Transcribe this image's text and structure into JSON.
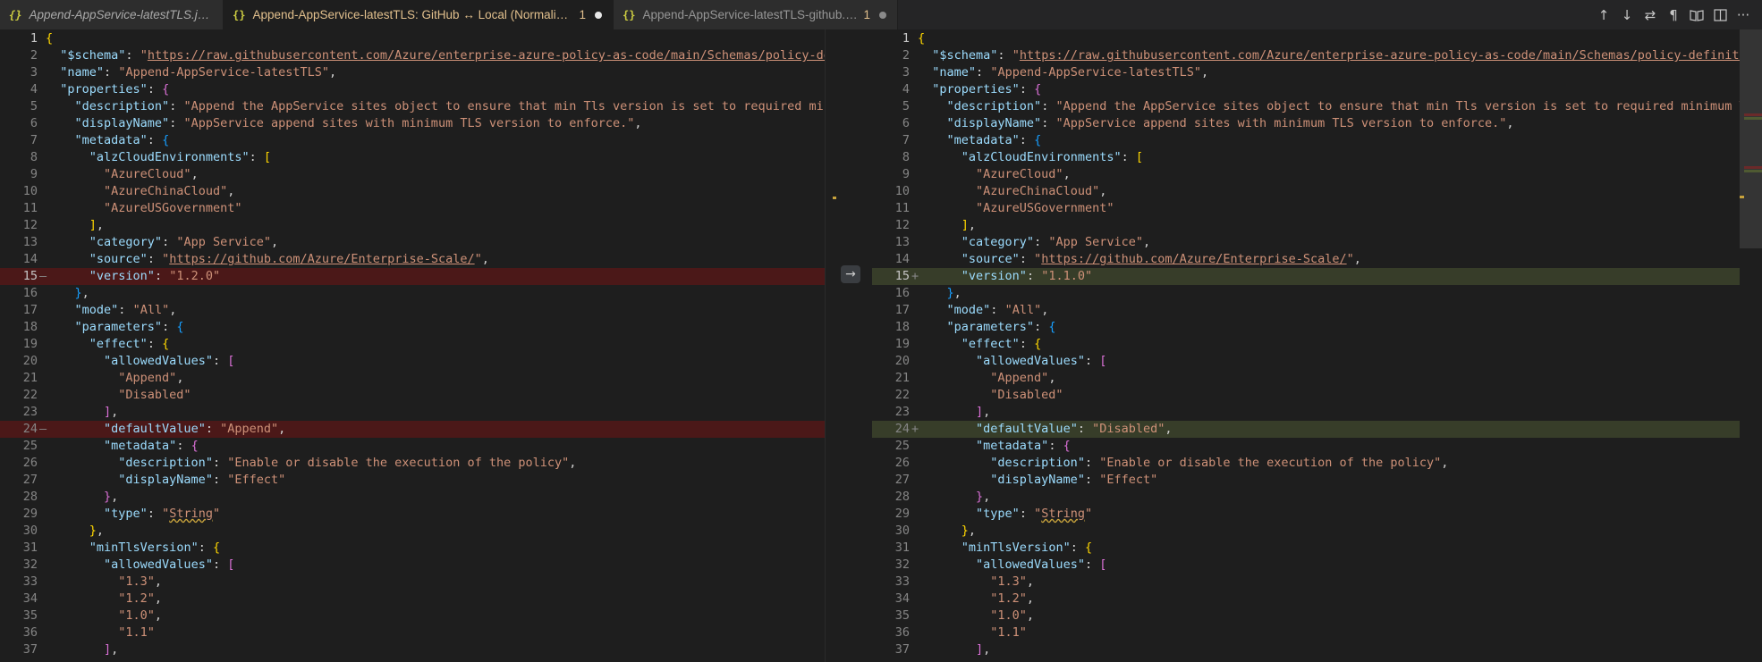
{
  "tabs": [
    {
      "label": "Append-AppService-latestTLS.json",
      "count": "",
      "dirty": false
    },
    {
      "label": "Append-AppService-latestTLS: GitHub ↔ Local (Normalized View)",
      "count": "1",
      "dirty": true
    },
    {
      "label": "Append-AppService-latestTLS-github.json",
      "count": "1",
      "dirty": true
    }
  ],
  "toolbar": {
    "prev_change": "↑",
    "next_change": "↓",
    "swap": "⇄",
    "whitespace": "¶",
    "open_file": "📖",
    "split": "◫",
    "more": "···"
  },
  "diff": {
    "arrow": "→",
    "left": {
      "lines": [
        {
          "n": "1",
          "t": "{"
        },
        {
          "n": "2",
          "t": "  \"$schema\": \"https://raw.githubusercontent.com/Azure/enterprise-azure-policy-as-code/main/Schemas/policy-definitio"
        },
        {
          "n": "3",
          "t": "  \"name\": \"Append-AppService-latestTLS\","
        },
        {
          "n": "4",
          "t": "  \"properties\": {"
        },
        {
          "n": "5",
          "t": "    \"description\": \"Append the AppService sites object to ensure that min Tls version is set to required minimum TL"
        },
        {
          "n": "6",
          "t": "    \"displayName\": \"AppService append sites with minimum TLS version to enforce.\","
        },
        {
          "n": "7",
          "t": "    \"metadata\": {"
        },
        {
          "n": "8",
          "t": "      \"alzCloudEnvironments\": ["
        },
        {
          "n": "9",
          "t": "        \"AzureCloud\","
        },
        {
          "n": "10",
          "t": "        \"AzureChinaCloud\","
        },
        {
          "n": "11",
          "t": "        \"AzureUSGovernment\""
        },
        {
          "n": "12",
          "t": "      ],"
        },
        {
          "n": "13",
          "t": "      \"category\": \"App Service\","
        },
        {
          "n": "14",
          "t": "      \"source\": \"https://github.com/Azure/Enterprise-Scale/\","
        },
        {
          "n": "15",
          "t": "      \"version\": \"1.2.0\""
        },
        {
          "n": "16",
          "t": "    },"
        },
        {
          "n": "17",
          "t": "    \"mode\": \"All\","
        },
        {
          "n": "18",
          "t": "    \"parameters\": {"
        },
        {
          "n": "19",
          "t": "      \"effect\": {"
        },
        {
          "n": "20",
          "t": "        \"allowedValues\": ["
        },
        {
          "n": "21",
          "t": "          \"Append\","
        },
        {
          "n": "22",
          "t": "          \"Disabled\""
        },
        {
          "n": "23",
          "t": "        ],"
        },
        {
          "n": "24",
          "t": "        \"defaultValue\": \"Append\","
        },
        {
          "n": "25",
          "t": "        \"metadata\": {"
        },
        {
          "n": "26",
          "t": "          \"description\": \"Enable or disable the execution of the policy\","
        },
        {
          "n": "27",
          "t": "          \"displayName\": \"Effect\""
        },
        {
          "n": "28",
          "t": "        },"
        },
        {
          "n": "29",
          "t": "        \"type\": \"String\""
        },
        {
          "n": "30",
          "t": "      },"
        },
        {
          "n": "31",
          "t": "      \"minTlsVersion\": {"
        },
        {
          "n": "32",
          "t": "        \"allowedValues\": ["
        },
        {
          "n": "33",
          "t": "          \"1.3\","
        },
        {
          "n": "34",
          "t": "          \"1.2\","
        },
        {
          "n": "35",
          "t": "          \"1.0\","
        },
        {
          "n": "36",
          "t": "          \"1.1\""
        },
        {
          "n": "37",
          "t": "        ],"
        }
      ]
    },
    "right": {
      "lines": [
        {
          "n": "1",
          "t": "{"
        },
        {
          "n": "2",
          "t": "  \"$schema\": \"https://raw.githubusercontent.com/Azure/enterprise-azure-policy-as-code/main/Schemas/policy-definition-sch"
        },
        {
          "n": "3",
          "t": "  \"name\": \"Append-AppService-latestTLS\","
        },
        {
          "n": "4",
          "t": "  \"properties\": {"
        },
        {
          "n": "5",
          "t": "    \"description\": \"Append the AppService sites object to ensure that min Tls version is set to required minimum TLS ver"
        },
        {
          "n": "6",
          "t": "    \"displayName\": \"AppService append sites with minimum TLS version to enforce.\","
        },
        {
          "n": "7",
          "t": "    \"metadata\": {"
        },
        {
          "n": "8",
          "t": "      \"alzCloudEnvironments\": ["
        },
        {
          "n": "9",
          "t": "        \"AzureCloud\","
        },
        {
          "n": "10",
          "t": "        \"AzureChinaCloud\","
        },
        {
          "n": "11",
          "t": "        \"AzureUSGovernment\""
        },
        {
          "n": "12",
          "t": "      ],"
        },
        {
          "n": "13",
          "t": "      \"category\": \"App Service\","
        },
        {
          "n": "14",
          "t": "      \"source\": \"https://github.com/Azure/Enterprise-Scale/\","
        },
        {
          "n": "15",
          "t": "      \"version\": \"1.1.0\""
        },
        {
          "n": "16",
          "t": "    },"
        },
        {
          "n": "17",
          "t": "    \"mode\": \"All\","
        },
        {
          "n": "18",
          "t": "    \"parameters\": {"
        },
        {
          "n": "19",
          "t": "      \"effect\": {"
        },
        {
          "n": "20",
          "t": "        \"allowedValues\": ["
        },
        {
          "n": "21",
          "t": "          \"Append\","
        },
        {
          "n": "22",
          "t": "          \"Disabled\""
        },
        {
          "n": "23",
          "t": "        ],"
        },
        {
          "n": "24",
          "t": "        \"defaultValue\": \"Disabled\","
        },
        {
          "n": "25",
          "t": "        \"metadata\": {"
        },
        {
          "n": "26",
          "t": "          \"description\": \"Enable or disable the execution of the policy\","
        },
        {
          "n": "27",
          "t": "          \"displayName\": \"Effect\""
        },
        {
          "n": "28",
          "t": "        },"
        },
        {
          "n": "29",
          "t": "        \"type\": \"String\""
        },
        {
          "n": "30",
          "t": "      },"
        },
        {
          "n": "31",
          "t": "      \"minTlsVersion\": {"
        },
        {
          "n": "32",
          "t": "        \"allowedValues\": ["
        },
        {
          "n": "33",
          "t": "          \"1.3\","
        },
        {
          "n": "34",
          "t": "          \"1.2\","
        },
        {
          "n": "35",
          "t": "          \"1.0\","
        },
        {
          "n": "36",
          "t": "          \"1.1\""
        },
        {
          "n": "37",
          "t": "        ],"
        }
      ]
    },
    "deleted_lines": [
      "15",
      "24"
    ],
    "inserted_lines": [
      "15",
      "24"
    ],
    "current_line": "15"
  },
  "colors": {
    "deleted_bg": "#4b1818",
    "inserted_bg": "#373d29",
    "key": "#9cdcfe",
    "string": "#ce9178"
  }
}
